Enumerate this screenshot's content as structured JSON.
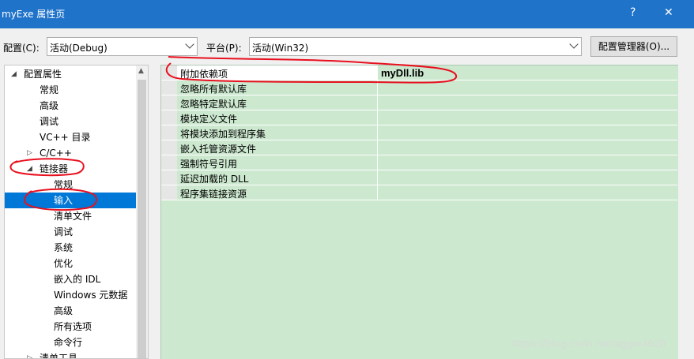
{
  "window": {
    "title": "myExe 属性页",
    "help_glyph": "?",
    "close_glyph": "✕"
  },
  "config": {
    "config_label": "配置(C):",
    "config_value": "活动(Debug)",
    "platform_label": "平台(P):",
    "platform_value": "活动(Win32)",
    "manager_button": "配置管理器(O)..."
  },
  "tree": {
    "items": [
      {
        "label": "配置属性",
        "expander": "◢",
        "selected": false
      },
      {
        "label": "常规",
        "selected": false
      },
      {
        "label": "高级",
        "selected": false
      },
      {
        "label": "调试",
        "selected": false
      },
      {
        "label": "VC++ 目录",
        "selected": false
      },
      {
        "label": "C/C++",
        "expander": "▷",
        "selected": false
      },
      {
        "label": "链接器",
        "expander": "◢",
        "selected": false
      },
      {
        "label": "常规",
        "selected": false
      },
      {
        "label": "输入",
        "selected": true
      },
      {
        "label": "清单文件",
        "selected": false
      },
      {
        "label": "调试",
        "selected": false
      },
      {
        "label": "系统",
        "selected": false
      },
      {
        "label": "优化",
        "selected": false
      },
      {
        "label": "嵌入的 IDL",
        "selected": false
      },
      {
        "label": "Windows 元数据",
        "selected": false
      },
      {
        "label": "高级",
        "selected": false
      },
      {
        "label": "所有选项",
        "selected": false
      },
      {
        "label": "命令行",
        "selected": false
      },
      {
        "label": "清单工具",
        "expander": "▷",
        "selected": false
      }
    ],
    "scroll_up_glyph": "▲"
  },
  "properties": {
    "rows": [
      {
        "name": "附加依赖项",
        "value": "myDll.lib"
      },
      {
        "name": "忽略所有默认库",
        "value": ""
      },
      {
        "name": "忽略特定默认库",
        "value": ""
      },
      {
        "name": "模块定义文件",
        "value": ""
      },
      {
        "name": "将模块添加到程序集",
        "value": ""
      },
      {
        "name": "嵌入托管资源文件",
        "value": ""
      },
      {
        "name": "强制符号引用",
        "value": ""
      },
      {
        "name": "延迟加载的 DLL",
        "value": ""
      },
      {
        "name": "程序集链接资源",
        "value": ""
      }
    ]
  },
  "watermark": "https://blog.csdn.net/aggie4628",
  "colors": {
    "titlebar": "#1f73c9",
    "grid_background": "#cce8cf",
    "selection": "#0078d7",
    "annotation": "#e8101f"
  }
}
